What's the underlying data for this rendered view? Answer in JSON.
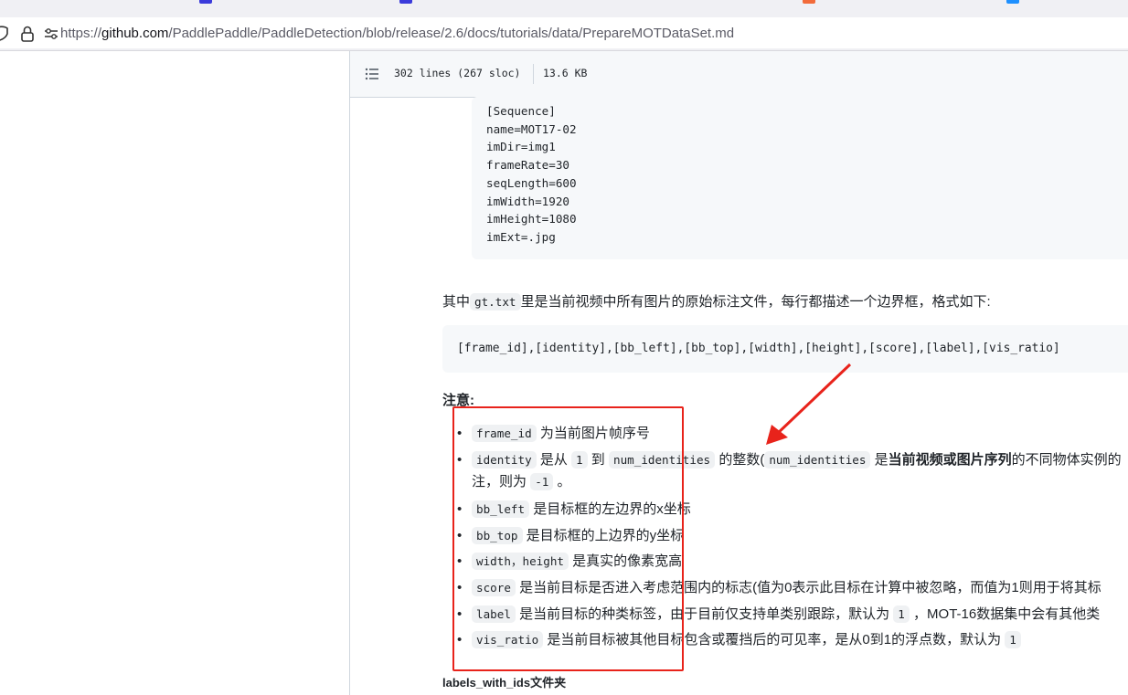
{
  "browser": {
    "url_prefix": "https://",
    "url_host": "github.com",
    "url_path": "/PaddlePaddle/PaddleDetection/blob/release/2.6/docs/tutorials/data/PrepareMOTDataSet.md"
  },
  "file_header": {
    "lines": "302 lines (267 sloc)",
    "size": "13.6 KB"
  },
  "seqinfo": [
    "[Sequence]",
    "name=MOT17-02",
    "imDir=img1",
    "frameRate=30",
    "seqLength=600",
    "imWidth=1920",
    "imHeight=1080",
    "imExt=.jpg"
  ],
  "gt_paragraph": {
    "before": "其中",
    "code": "gt.txt",
    "after": "里是当前视频中所有图片的原始标注文件，每行都描述一个边界框，格式如下:"
  },
  "format_line": "[frame_id],[identity],[bb_left],[bb_top],[width],[height],[score],[label],[vis_ratio]",
  "note_title": "注意:",
  "items": [
    {
      "code": "frame_id",
      "text": "为当前图片帧序号"
    },
    {
      "code": "identity",
      "t1": "是从",
      "c2": "1",
      "t2": "到",
      "c3": "num_identities",
      "t3": "的整数(",
      "c4": "num_identities",
      "t4": "是",
      "bold": "当前视频或图片序列",
      "t5": "的不同物体实例的",
      "line2a": "注，则为",
      "line2code": "-1",
      "line2b": "。"
    },
    {
      "code": "bb_left",
      "text": "是目标框的左边界的x坐标"
    },
    {
      "code": "bb_top",
      "text": "是目标框的上边界的y坐标"
    },
    {
      "code": "width，height",
      "text": "是真实的像素宽高"
    },
    {
      "code": "score",
      "text": "是当前目标是否进入考虑范围内的标志(值为0表示此目标在计算中被忽略，而值为1则用于将其标"
    },
    {
      "code": "label",
      "text": "是当前目标的种类标签，由于目前仅支持单类别跟踪，默认为",
      "code2": "1",
      "text2": "，MOT-16数据集中会有其他类"
    },
    {
      "code": "vis_ratio",
      "text": "是当前目标被其他目标包含或覆挡后的可见率，是从0到1的浮点数，默认为",
      "code2": "1"
    }
  ],
  "next_heading": "labels_with_ids文件夹",
  "colors": {
    "highlight": "#e8231b",
    "code_bg": "#f6f8fa"
  }
}
